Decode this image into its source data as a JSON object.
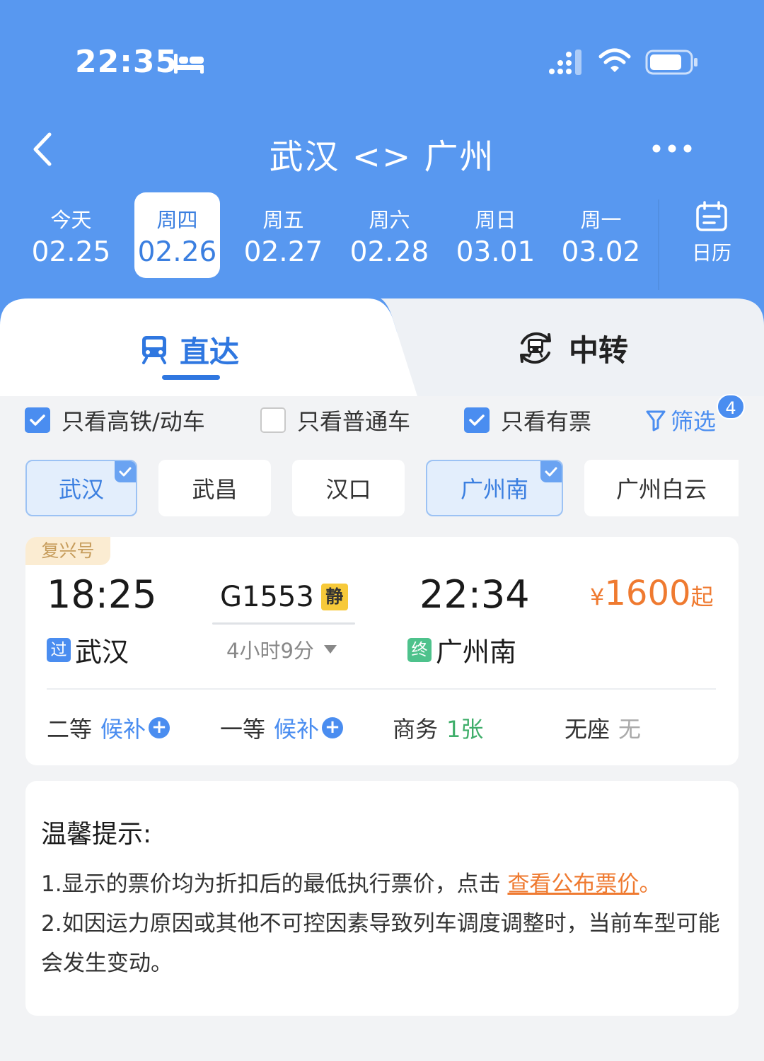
{
  "status_bar": {
    "time": "22:35"
  },
  "nav": {
    "title": "武汉 <> 广州"
  },
  "dates": [
    {
      "weekday": "今天",
      "date": "02.25",
      "active": false
    },
    {
      "weekday": "周四",
      "date": "02.26",
      "active": true
    },
    {
      "weekday": "周五",
      "date": "02.27",
      "active": false
    },
    {
      "weekday": "周六",
      "date": "02.28",
      "active": false
    },
    {
      "weekday": "周日",
      "date": "03.01",
      "active": false
    },
    {
      "weekday": "周一",
      "date": "03.02",
      "active": false
    }
  ],
  "calendar": {
    "label": "日历"
  },
  "tabs": {
    "direct": "直达",
    "transfer": "中转"
  },
  "filters": [
    {
      "label": "只看高铁/动车",
      "checked": true
    },
    {
      "label": "只看普通车",
      "checked": false
    },
    {
      "label": "只看有票",
      "checked": true
    }
  ],
  "filter_button": {
    "label": "筛选",
    "badge": "4"
  },
  "stations": [
    {
      "name": "武汉",
      "selected": true
    },
    {
      "name": "武昌",
      "selected": false
    },
    {
      "name": "汉口",
      "selected": false
    },
    {
      "name": "广州南",
      "selected": true
    },
    {
      "name": "广州白云",
      "selected": false
    }
  ],
  "train": {
    "tag": "复兴号",
    "depart_time": "18:25",
    "depart_tag": "过",
    "depart_station": "武汉",
    "number": "G1553",
    "quiet_badge": "静",
    "duration": "4小时9分",
    "arrive_time": "22:34",
    "arrive_tag": "终",
    "arrive_station": "广州南",
    "price_currency": "¥",
    "price": "1600",
    "price_suffix": "起",
    "seats": [
      {
        "class": "二等",
        "status": "候补"
      },
      {
        "class": "一等",
        "status": "候补"
      },
      {
        "class": "商务",
        "status": "1张"
      },
      {
        "class": "无座",
        "status": "无"
      }
    ]
  },
  "tips": {
    "title": "温馨提示:",
    "line1_text": "1.显示的票价均为折扣后的最低执行票价，点击 ",
    "line1_link": "查看公布票价",
    "line1_end": "。",
    "line2": "2.如因运力原因或其他不可控因素导致列车调度调整时，当前车型可能会发生变动。"
  },
  "colors": {
    "header_bg": "#5898f0",
    "accent": "#4a8df0",
    "price": "#ef7a30",
    "available": "#3fae6a"
  }
}
